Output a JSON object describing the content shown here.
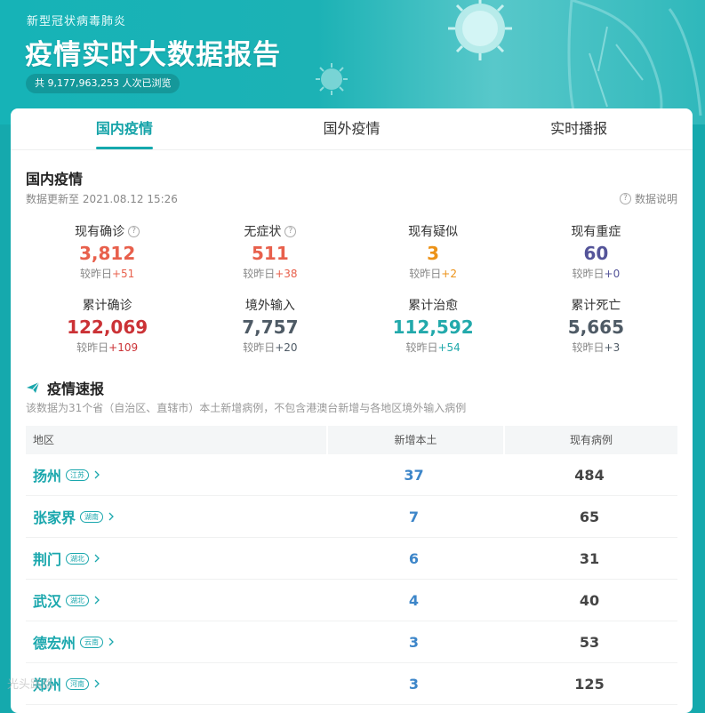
{
  "header": {
    "subtitle": "新型冠状病毒肺炎",
    "title": "疫情实时大数据报告",
    "views": "共 9,177,963,253 人次已浏览"
  },
  "tabs": [
    {
      "label": "国内疫情",
      "active": true
    },
    {
      "label": "国外疫情",
      "active": false
    },
    {
      "label": "实时播报",
      "active": false
    }
  ],
  "domestic": {
    "title": "国内疫情",
    "updated": "数据更新至 2021.08.12 15:26",
    "explain": "数据说明",
    "stats_row1": [
      {
        "label": "现有确诊",
        "value": "3,812",
        "cmp_prefix": "较昨日",
        "delta": "+51",
        "color": "#e8604c",
        "delta_color": "#e8604c",
        "help": true
      },
      {
        "label": "无症状",
        "value": "511",
        "cmp_prefix": "较昨日",
        "delta": "+38",
        "color": "#e8604c",
        "delta_color": "#e8604c",
        "help": true
      },
      {
        "label": "现有疑似",
        "value": "3",
        "cmp_prefix": "较昨日",
        "delta": "+2",
        "color": "#ec9217",
        "delta_color": "#ec9217",
        "help": false
      },
      {
        "label": "现有重症",
        "value": "60",
        "cmp_prefix": "较昨日",
        "delta": "+0",
        "color": "#545499",
        "delta_color": "#545499",
        "help": false
      }
    ],
    "stats_row2": [
      {
        "label": "累计确诊",
        "value": "122,069",
        "cmp_prefix": "较昨日",
        "delta": "+109",
        "color": "#cb3236",
        "delta_color": "#cb3236"
      },
      {
        "label": "境外输入",
        "value": "7,757",
        "cmp_prefix": "较昨日",
        "delta": "+20",
        "color": "#4e5a65",
        "delta_color": "#4e5a65"
      },
      {
        "label": "累计治愈",
        "value": "112,592",
        "cmp_prefix": "较昨日",
        "delta": "+54",
        "color": "#22a9ab",
        "delta_color": "#22a9ab"
      },
      {
        "label": "累计死亡",
        "value": "5,665",
        "cmp_prefix": "较昨日",
        "delta": "+3",
        "color": "#4e5a65",
        "delta_color": "#4e5a65"
      }
    ]
  },
  "flash": {
    "title": "疫情速报",
    "note": "该数据为31个省（自治区、直辖市）本土新增病例，不包含港澳台新增与各地区境外输入病例",
    "columns": [
      "地区",
      "新增本土",
      "现有病例"
    ],
    "rows": [
      {
        "city": "扬州",
        "province": "江苏",
        "new_local": "37",
        "current": "484"
      },
      {
        "city": "张家界",
        "province": "湖南",
        "new_local": "7",
        "current": "65"
      },
      {
        "city": "荆门",
        "province": "湖北",
        "new_local": "6",
        "current": "31"
      },
      {
        "city": "武汉",
        "province": "湖北",
        "new_local": "4",
        "current": "40"
      },
      {
        "city": "德宏州",
        "province": "云南",
        "new_local": "3",
        "current": "53"
      },
      {
        "city": "郑州",
        "province": "河南",
        "new_local": "3",
        "current": "125"
      }
    ]
  },
  "watermark": "光头路路"
}
